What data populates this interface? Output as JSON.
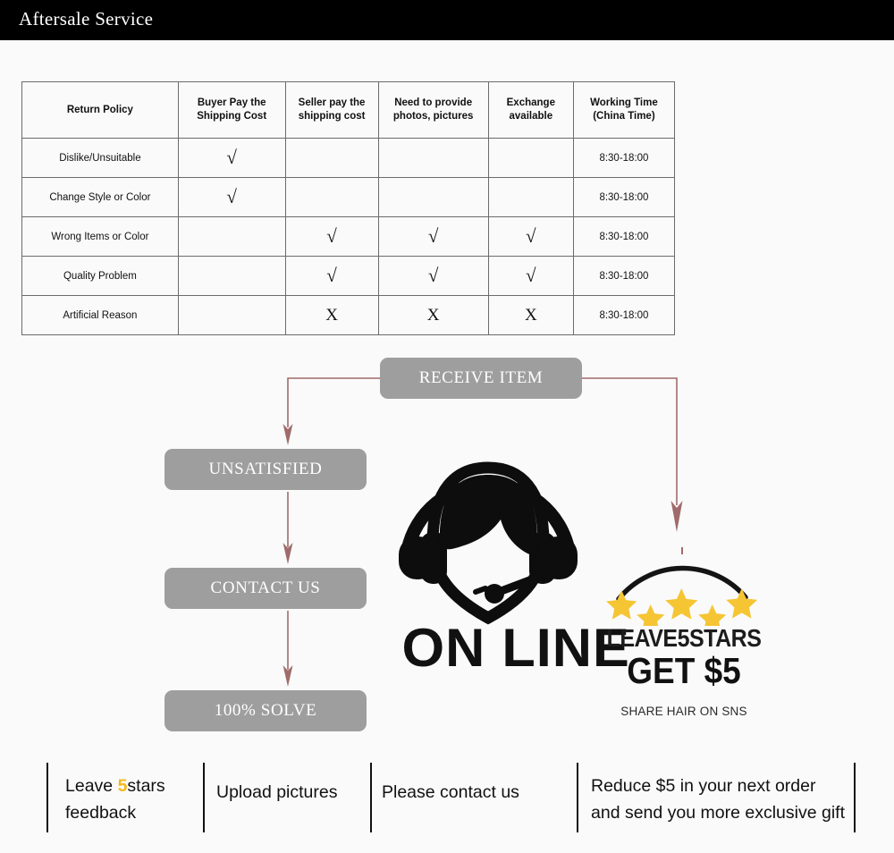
{
  "header": {
    "title": "Aftersale Service"
  },
  "table": {
    "headers": [
      "Return Policy",
      "Buyer Pay the Shipping Cost",
      "Seller pay the shipping cost",
      "Need to provide photos, pictures",
      "Exchange available",
      "Working Time (China Time)"
    ],
    "headers_lines": {
      "h0": "Return Policy",
      "h1a": "Buyer Pay the",
      "h1b": "Shipping Cost",
      "h2a": "Seller pay the",
      "h2b": "shipping cost",
      "h3a": "Need to provide",
      "h3b": "photos, pictures",
      "h4a": "Exchange",
      "h4b": "available",
      "h5a": "Working Time",
      "h5b": "(China Time)"
    },
    "rows": [
      {
        "reason": "Dislike/Unsuitable",
        "buyer_pay": "√",
        "seller_pay": "",
        "photos": "",
        "exchange": "",
        "working_time": "8:30-18:00"
      },
      {
        "reason": "Change Style or Color",
        "buyer_pay": "√",
        "seller_pay": "",
        "photos": "",
        "exchange": "",
        "working_time": "8:30-18:00"
      },
      {
        "reason": "Wrong Items or Color",
        "buyer_pay": "",
        "seller_pay": "√",
        "photos": "√",
        "exchange": "√",
        "working_time": "8:30-18:00"
      },
      {
        "reason": "Quality Problem",
        "buyer_pay": "",
        "seller_pay": "√",
        "photos": "√",
        "exchange": "√",
        "working_time": "8:30-18:00"
      },
      {
        "reason": "Artificial Reason",
        "buyer_pay": "",
        "seller_pay": "X",
        "photos": "X",
        "exchange": "X",
        "working_time": "8:30-18:00"
      }
    ]
  },
  "flow": {
    "receive": "RECEIVE ITEM",
    "unsatisfied": "UNSATISFIED",
    "contact": "CONTACT US",
    "solve": "100% SOLVE",
    "box_color": "#9e9e9e",
    "arrow_color": "#a06b6b"
  },
  "agent": {
    "label": "ON LINE",
    "icon": "headset-operator-icon"
  },
  "promo": {
    "line1": "LEAVE5STARS",
    "line2": "GET $5",
    "line3": "SHARE HAIR ON SNS",
    "star_color": "#f5c534",
    "star_count": 5
  },
  "bottom": {
    "cells": [
      {
        "pre": "Leave ",
        "highlight": "5",
        "post": "stars",
        "line2": "feedback"
      },
      {
        "pre": "Upload pictures",
        "highlight": "",
        "post": "",
        "line2": ""
      },
      {
        "pre": "Please contact us",
        "highlight": "",
        "post": "",
        "line2": ""
      },
      {
        "pre": "Reduce $5 in your next order",
        "highlight": "",
        "post": "",
        "line2": "and send you more exclusive gift"
      }
    ]
  }
}
